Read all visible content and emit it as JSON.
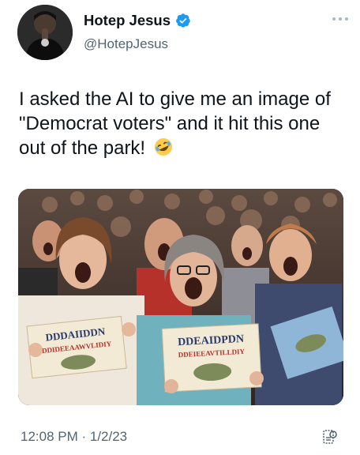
{
  "tweet": {
    "display_name": "Hotep Jesus",
    "handle": "@HotepJesus",
    "text": "I asked the AI to give me an image of \"Democrat voters\" and it hit this one out of the park!",
    "emoji": "rolling-on-floor-laughing",
    "timestamp": "12:08 PM · 1/2/23"
  },
  "media": {
    "sign_left_line1": "DDDAIIDDN",
    "sign_left_line2": "DDIDEEAAWVLIDIY",
    "sign_right_line1": "DDEAIDPDN",
    "sign_right_line2": "DDEIEEAVTILLDIY"
  },
  "icons": {
    "verified": "verified-badge-icon",
    "more": "more-dots-icon",
    "footer": "analytics-icon"
  },
  "colors": {
    "verified_blue": "#1d9bf0",
    "secondary_text": "#536471",
    "primary_text": "#0f1419"
  }
}
